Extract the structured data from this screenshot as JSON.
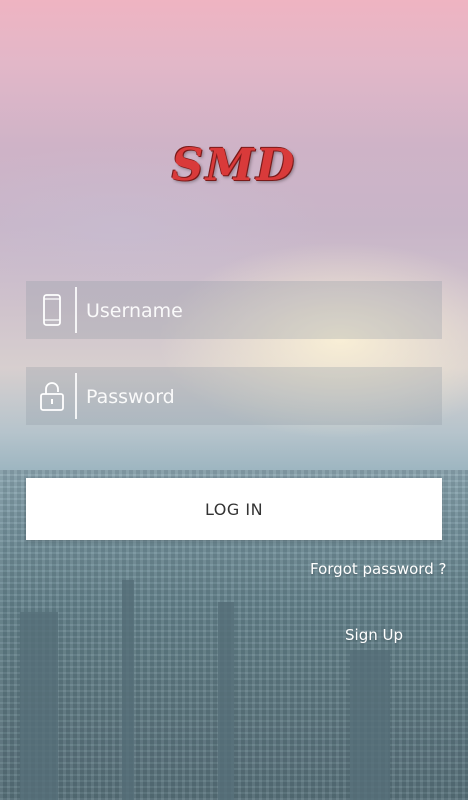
{
  "logo": {
    "text": "SMD"
  },
  "username": {
    "placeholder": "Username",
    "icon": "phone-icon"
  },
  "password": {
    "placeholder": "Password",
    "icon": "lock-icon"
  },
  "login_label": "LOG IN",
  "forgot_label": "Forgot password ?",
  "signup_label": "Sign Up",
  "colors": {
    "logo_red": "#d93a3a",
    "button_bg": "#ffffff"
  }
}
